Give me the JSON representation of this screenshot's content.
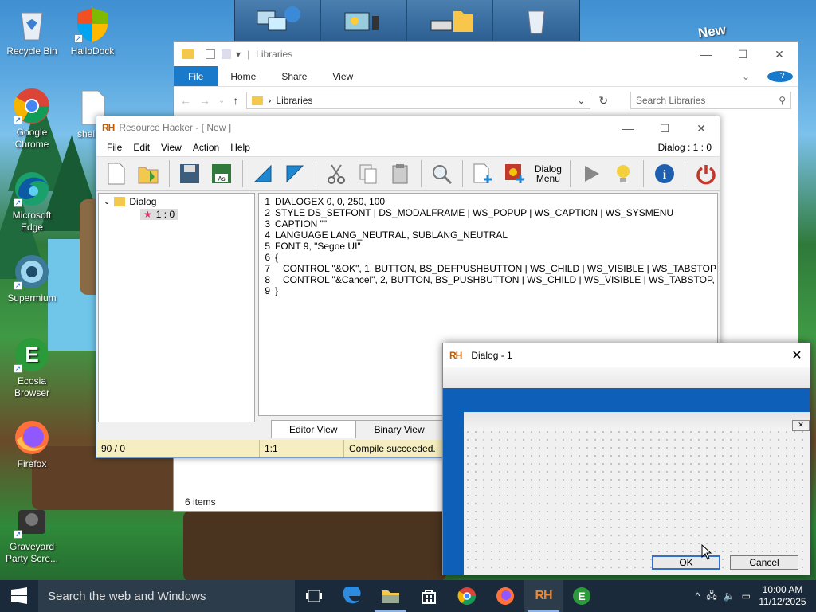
{
  "desktop": {
    "icons": [
      {
        "label": "Recycle Bin"
      },
      {
        "label": "HalloDock"
      },
      {
        "label": "Google Chrome"
      },
      {
        "label": "shell32"
      },
      {
        "label": "Microsoft Edge"
      },
      {
        "label": "Supermium"
      },
      {
        "label": "Ecosia Browser"
      },
      {
        "label": "Firefox"
      },
      {
        "label": "Graveyard Party Scre..."
      }
    ],
    "wallpaper_sign": "New"
  },
  "explorer": {
    "title": "Libraries",
    "tabs": [
      "File",
      "Home",
      "Share",
      "View"
    ],
    "address": "Libraries",
    "search_placeholder": "Search Libraries",
    "status": "6 items"
  },
  "rh": {
    "title": "Resource Hacker - [ New ]",
    "menu": [
      "File",
      "Edit",
      "View",
      "Action",
      "Help"
    ],
    "resource_id": "Dialog : 1 : 0",
    "toolbar_dialog_label": "Dialog Menu",
    "tree": {
      "root": "Dialog",
      "child": "1 : 0"
    },
    "code": [
      "DIALOGEX 0, 0, 250, 100",
      "STYLE DS_SETFONT | DS_MODALFRAME | WS_POPUP | WS_CAPTION | WS_SYSMENU",
      "CAPTION \"\"",
      "LANGUAGE LANG_NEUTRAL, SUBLANG_NEUTRAL",
      "FONT 9, \"Segoe UI\"",
      "{",
      "   CONTROL \"&OK\", 1, BUTTON, BS_DEFPUSHBUTTON | WS_CHILD | WS_VISIBLE | WS_TABSTOP",
      "   CONTROL \"&Cancel\", 2, BUTTON, BS_PUSHBUTTON | WS_CHILD | WS_VISIBLE | WS_TABSTOP,",
      "}"
    ],
    "line_numbers": [
      "1",
      "2",
      "3",
      "4",
      "5",
      "6",
      "7",
      "8",
      "9"
    ],
    "tabs": {
      "editor": "Editor View",
      "binary": "Binary View"
    },
    "status": {
      "pos": "90 / 0",
      "cursor": "1:1",
      "message": "Compile succeeded."
    }
  },
  "dialog": {
    "title": "Dialog - 1",
    "ok": "OK",
    "cancel": "Cancel"
  },
  "taskbar": {
    "search": "Search the web and Windows",
    "time": "10:00 AM",
    "date": "11/12/2025"
  }
}
